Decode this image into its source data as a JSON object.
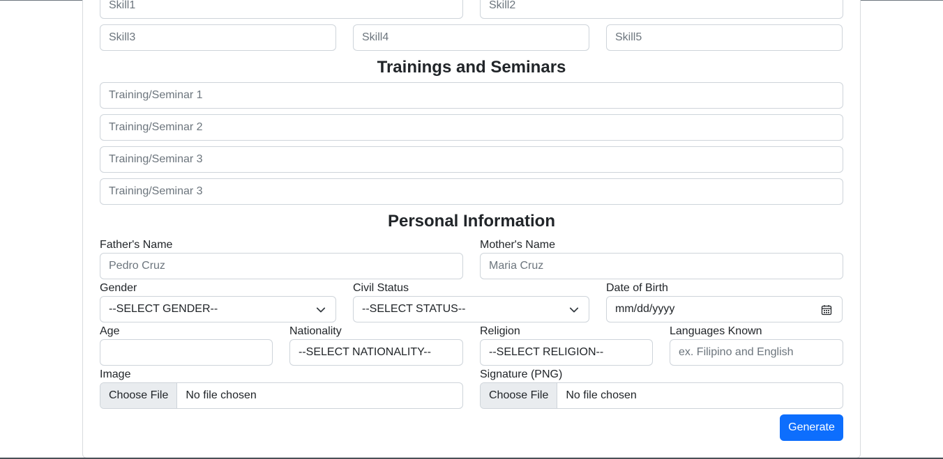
{
  "skills": {
    "skill1_placeholder": "Skill1",
    "skill2_placeholder": "Skill2",
    "skill3_placeholder": "Skill3",
    "skill4_placeholder": "Skill4",
    "skill5_placeholder": "Skill5"
  },
  "trainings": {
    "heading": "Trainings and Seminars",
    "items": [
      "Training/Seminar 1",
      "Training/Seminar 2",
      "Training/Seminar 3",
      "Training/Seminar 3"
    ]
  },
  "personal": {
    "heading": "Personal Information",
    "father_label": "Father's Name",
    "father_placeholder": "Pedro Cruz",
    "mother_label": "Mother's Name",
    "mother_placeholder": "Maria Cruz",
    "gender_label": "Gender",
    "gender_value": "--SELECT GENDER--",
    "civil_label": "Civil Status",
    "civil_value": "--SELECT STATUS--",
    "dob_label": "Date of Birth",
    "dob_value": "mm/dd/yyyy",
    "age_label": "Age",
    "age_value": "",
    "nationality_label": "Nationality",
    "nationality_value": "--SELECT NATIONALITY--",
    "religion_label": "Religion",
    "religion_value": "--SELECT RELIGION--",
    "languages_label": "Languages Known",
    "languages_placeholder": "ex. Filipino and English",
    "image_label": "Image",
    "signature_label": "Signature (PNG)",
    "choose_file": "Choose File",
    "no_file": "No file chosen"
  },
  "generate_label": "Generate",
  "colors": {
    "primary": "#0d6efd",
    "border": "#ced4da",
    "placeholder": "#6c757d"
  },
  "icons": {
    "select": "chevron-down-icon",
    "date": "calendar-icon"
  }
}
